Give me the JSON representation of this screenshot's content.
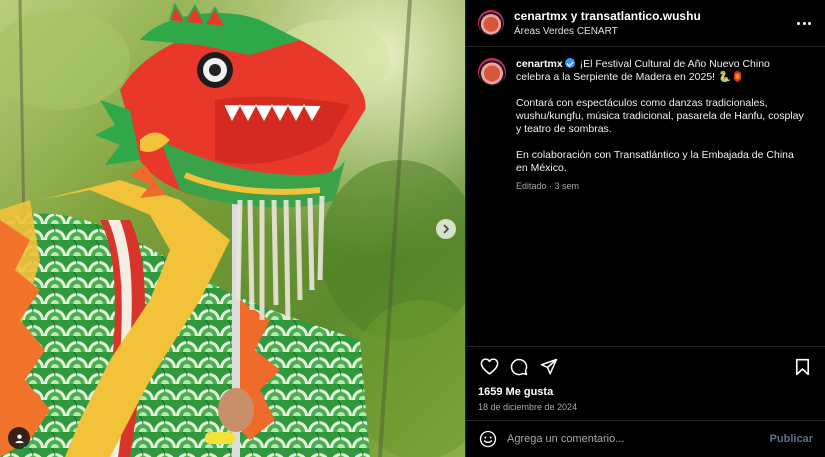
{
  "post": {
    "header": {
      "username": "cenartmx",
      "connector": "y",
      "collaborator": "transatlantico.wushu",
      "location": "Áreas Verdes CENART"
    },
    "caption": {
      "username": "cenartmx",
      "line1": "¡El Festival Cultural de Año Nuevo Chino celebra a la Serpiente de Madera en 2025! 🐍🏮",
      "line2": "Contará con espectáculos como danzas tradicionales, wushu/kungfu, música tradicional, pasarela de Hanfu, cosplay y teatro de sombras.",
      "line3": "En colaboración con Transatlántico y la Embajada de China en México.",
      "meta": "Editado · 3 sem"
    },
    "likes": "1659 Me gusta",
    "date": "18 de diciembre de 2024",
    "comment": {
      "placeholder": "Agrega un comentario...",
      "publish_label": "Publicar"
    }
  },
  "icons": {
    "like": "heart-icon",
    "comment": "comment-icon",
    "share": "send-icon",
    "save": "bookmark-icon",
    "emoji": "emoji-icon",
    "more": "more-options-icon",
    "next": "chevron-right-icon",
    "tag": "user-tag-icon"
  },
  "colors": {
    "background": "#000000",
    "divider": "#262626",
    "secondary_text": "#a8a8a8",
    "verified": "#3897f0",
    "publish_disabled": "#5a6f8f"
  }
}
